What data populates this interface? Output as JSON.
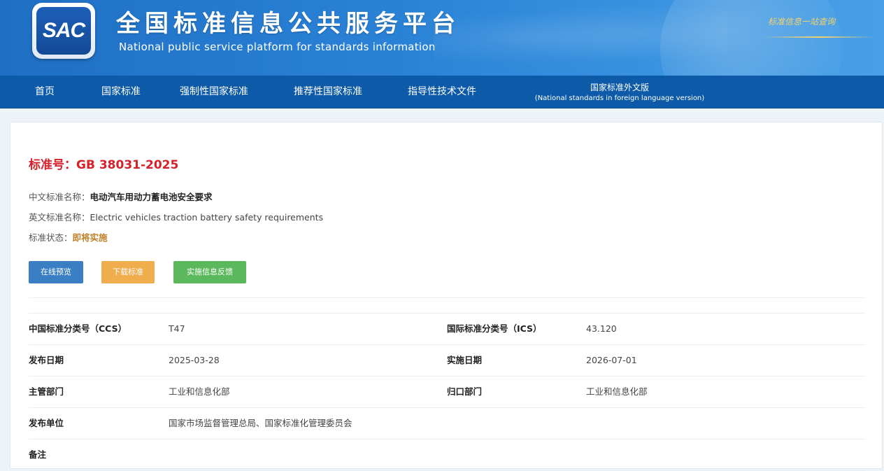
{
  "header": {
    "logo_text": "SAC",
    "title_cn": "全国标准信息公共服务平台",
    "title_en": "National public service platform  for standards information",
    "slogan": "标准信息一站查询"
  },
  "nav": {
    "items": [
      {
        "label": "首页"
      },
      {
        "label": "国家标准"
      },
      {
        "label": "强制性国家标准"
      },
      {
        "label": "推荐性国家标准"
      },
      {
        "label": "指导性技术文件"
      }
    ],
    "foreign": {
      "label_cn": "国家标准外文版",
      "label_en": "(National standards in foreign language version)"
    }
  },
  "standard": {
    "number_label": "标准号：",
    "number": "GB 38031-2025",
    "cn_name_label": "中文标准名称：",
    "cn_name": "电动汽车用动力蓄电池安全要求",
    "en_name_label": "英文标准名称：",
    "en_name": "Electric vehicles traction battery safety requirements",
    "status_label": "标准状态：",
    "status": "即将实施"
  },
  "buttons": {
    "preview": "在线预览",
    "download": "下载标准",
    "feedback": "实施信息反馈"
  },
  "details": {
    "rows": [
      {
        "k1": "中国标准分类号（CCS）",
        "v1": "T47",
        "k2": "国际标准分类号（ICS）",
        "v2": "43.120"
      },
      {
        "k1": "发布日期",
        "v1": "2025-03-28",
        "k2": "实施日期",
        "v2": "2026-07-01"
      },
      {
        "k1": "主管部门",
        "v1": "工业和信息化部",
        "k2": "归口部门",
        "v2": "工业和信息化部"
      },
      {
        "k1": "发布单位",
        "v1": "国家市场监督管理总局、国家标准化管理委员会",
        "k2": "",
        "v2": ""
      },
      {
        "k1": "备注",
        "v1": "",
        "k2": "",
        "v2": ""
      }
    ]
  },
  "colors": {
    "header_blue": "#2a82d6",
    "nav_blue": "#0c5aa8",
    "std_red": "#d6202a",
    "btn_blue": "#3a7fc3",
    "btn_orange": "#f0ad4e",
    "btn_green": "#5cb85c"
  }
}
